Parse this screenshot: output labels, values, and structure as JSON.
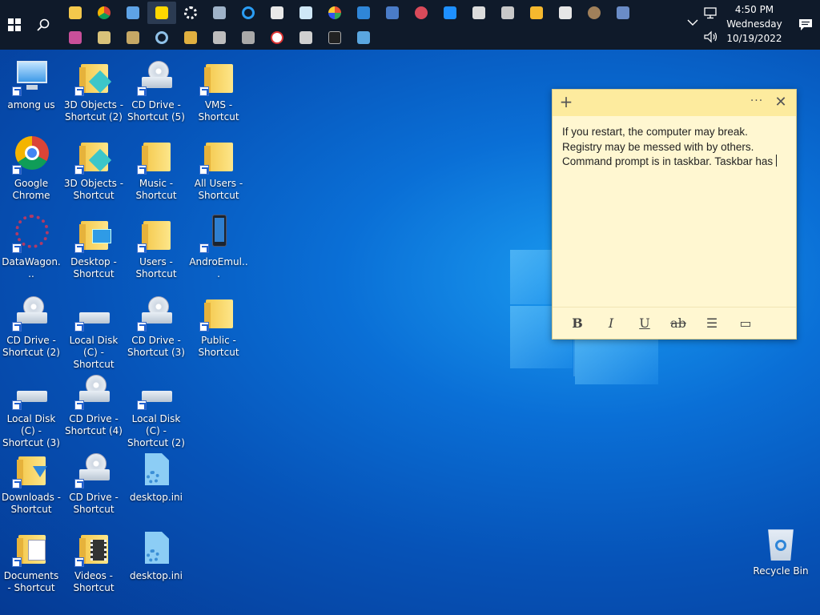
{
  "taskbar": {
    "row1_icons": [
      "file-explorer-icon",
      "chrome-icon",
      "mstsc-icon",
      "sticky-notes-icon",
      "settings-gear-icon",
      "network-icon",
      "ie-icon",
      "pen-tablet-icon",
      "notepad-icon",
      "paint-icon",
      "remote-desktop-icon",
      "device-icon",
      "cloud-icon",
      "calc-icon",
      "control-panel-icon",
      "printer-icon",
      "media-player-icon",
      "document-icon",
      "photos-icon",
      "system-icon"
    ],
    "row2_icons": [
      "archive-icon",
      "drive-icon",
      "book-icon",
      "magnifier-icon",
      "security-icon",
      "scanner-icon",
      "hardware-icon",
      "compass-icon",
      "printer2-icon",
      "cmd-icon",
      "display-icon"
    ],
    "clock": {
      "time": "4:50 PM",
      "day": "Wednesday",
      "date": "10/19/2022"
    }
  },
  "desktop": {
    "icons": [
      {
        "label": "among us",
        "kind": "pc"
      },
      {
        "label": "3D Objects - Shortcut (2)",
        "kind": "folder3d"
      },
      {
        "label": "CD Drive - Shortcut (5)",
        "kind": "cd"
      },
      {
        "label": "VMS - Shortcut",
        "kind": "folder"
      },
      {
        "label": "Google Chrome",
        "kind": "chrome"
      },
      {
        "label": "3D Objects - Shortcut",
        "kind": "folder3d"
      },
      {
        "label": "Music - Shortcut",
        "kind": "folder"
      },
      {
        "label": "All Users - Shortcut",
        "kind": "folder"
      },
      {
        "label": "DataWagon...",
        "kind": "datawagon"
      },
      {
        "label": "Desktop - Shortcut",
        "kind": "folder-desktop"
      },
      {
        "label": "Users - Shortcut",
        "kind": "folder"
      },
      {
        "label": "AndroEmul...",
        "kind": "phone"
      },
      {
        "label": "CD Drive - Shortcut (2)",
        "kind": "cd"
      },
      {
        "label": "Local Disk (C) - Shortcut",
        "kind": "disk"
      },
      {
        "label": "CD Drive - Shortcut (3)",
        "kind": "cd"
      },
      {
        "label": "Public - Shortcut",
        "kind": "folder"
      },
      {
        "label": "Local Disk (C) - Shortcut (3)",
        "kind": "disk"
      },
      {
        "label": "CD Drive - Shortcut (4)",
        "kind": "cd"
      },
      {
        "label": "Local Disk (C) - Shortcut (2)",
        "kind": "disk"
      },
      {
        "label": "Downloads - Shortcut",
        "kind": "folder"
      },
      {
        "label": "CD Drive - Shortcut",
        "kind": "cd"
      },
      {
        "label": "desktop.ini",
        "kind": "ini"
      },
      {
        "label": "Documents - Shortcut",
        "kind": "folder"
      },
      {
        "label": "Videos - Shortcut",
        "kind": "folder"
      },
      {
        "label": "desktop.ini",
        "kind": "ini"
      }
    ],
    "recycle_bin": "Recycle Bin"
  },
  "sticky_note": {
    "add_glyph": "+",
    "more_glyph": "···",
    "close_glyph": "✕",
    "lines": [
      "If you restart, the computer may break.",
      "Registry may be messed with by others.",
      "Command prompt is in taskbar. Taskbar has "
    ],
    "toolbar": {
      "bold": "B",
      "italic": "I",
      "underline": "U",
      "strikethrough": "ab",
      "list": "☰",
      "image": "▭"
    }
  },
  "colors": {
    "taskbar_bg": "#0f1a2a",
    "sticky_bg": "#fff7d1",
    "sticky_header": "#fdeb9e"
  }
}
